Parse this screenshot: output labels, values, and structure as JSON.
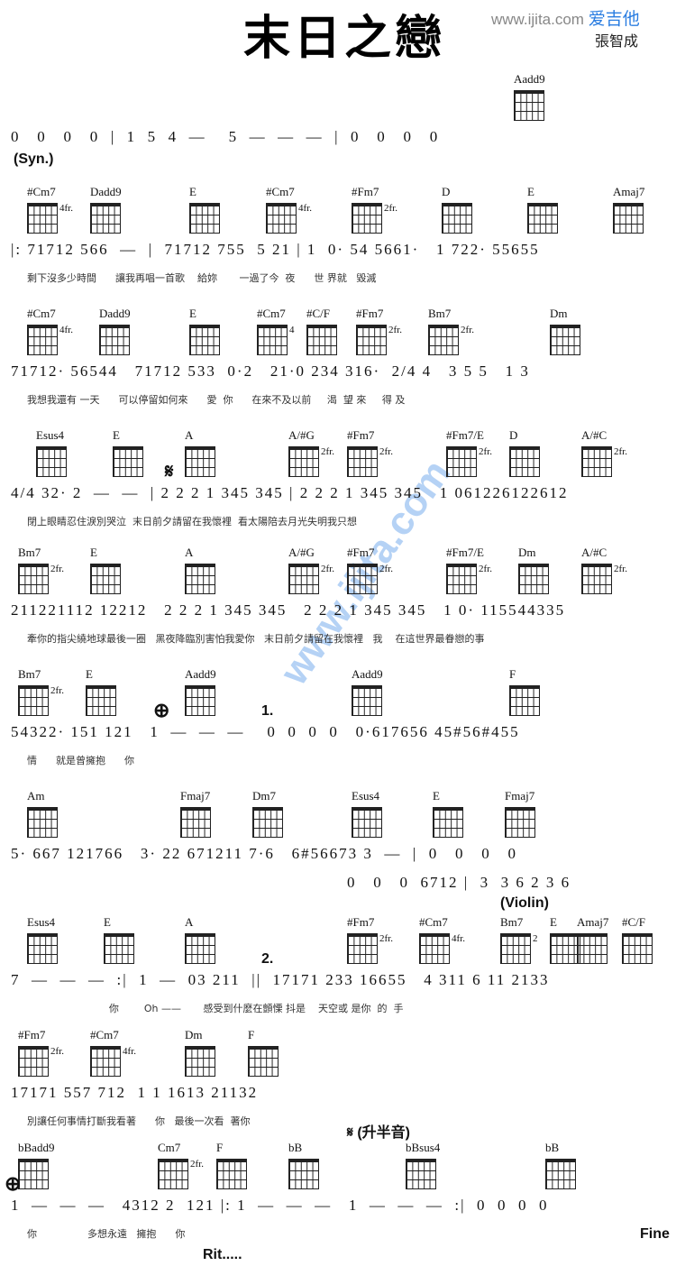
{
  "header": {
    "title": "末日之戀",
    "site": "www.ijita.com",
    "brand": "爱吉他",
    "artist": "張智成"
  },
  "watermark": "www.ijita.com",
  "lines": [
    {
      "chords": [
        {
          "name": "Aadd9"
        }
      ],
      "notes": "0   0   0   0  |  1  5  4  —    5  —  —  —  |  0   0   0   0",
      "lyrics": "",
      "label": "(Syn.)"
    },
    {
      "chords": [
        {
          "name": "#Cm7",
          "fr": "4fr."
        },
        {
          "name": "Dadd9"
        },
        {
          "name": "E"
        },
        {
          "name": "#Cm7",
          "fr": "4fr."
        },
        {
          "name": "#Fm7",
          "fr": "2fr."
        },
        {
          "name": "D"
        },
        {
          "name": "E"
        },
        {
          "name": "Amaj7"
        }
      ],
      "notes": "|: 71712 566  —  |  71712 755  5 21 | 1  0· 54 5661·   1 722· 55655",
      "lyrics": "剩下沒多少時間      讓我再唱一首歌    給妳       一過了今  夜      世 界就   毀滅"
    },
    {
      "chords": [
        {
          "name": "#Cm7",
          "fr": "4fr."
        },
        {
          "name": "Dadd9"
        },
        {
          "name": "E"
        },
        {
          "name": "#Cm7",
          "fr": "4"
        },
        {
          "name": "#C/F"
        },
        {
          "name": "#Fm7",
          "fr": "2fr."
        },
        {
          "name": "Bm7",
          "fr": "2fr."
        },
        {
          "name": "Dm"
        }
      ],
      "notes": "71712· 56544   71712 533  0·2   21·0 234 316·  2/4 4   3 5 5   1 3",
      "lyrics": "我想我還有 一天      可以停留如何來      愛  你      在來不及以前     渴  望 來     得 及"
    },
    {
      "chords": [
        {
          "name": "Esus4"
        },
        {
          "name": "E"
        },
        {
          "name": "A"
        },
        {
          "name": "A/#G",
          "fr": "2fr."
        },
        {
          "name": "#Fm7",
          "fr": "2fr."
        },
        {
          "name": "#Fm7/E",
          "fr": "2fr."
        },
        {
          "name": "D"
        },
        {
          "name": "A/#C",
          "fr": "2fr."
        }
      ],
      "notes": "4/4 32· 2  —  —  | 2 2 2 1 345 345 | 2 2 2 1 345 345   1 061226122612",
      "lyrics": "閉上眼睛忍住淚別哭泣  末日前夕請留在我懷裡  看太陽陪去月光失明我只想",
      "sign": "segno"
    },
    {
      "chords": [
        {
          "name": "Bm7",
          "fr": "2fr."
        },
        {
          "name": "E"
        },
        {
          "name": "A"
        },
        {
          "name": "A/#G",
          "fr": "2fr."
        },
        {
          "name": "#Fm7",
          "fr": "2fr."
        },
        {
          "name": "#Fm7/E",
          "fr": "2fr."
        },
        {
          "name": "Dm"
        },
        {
          "name": "A/#C",
          "fr": "2fr."
        }
      ],
      "notes": "211221112 12212   2 2 2 1 345 345   2 2 2 1 345 345   1 0· 115544335",
      "lyrics": "牽你的指尖繞地球最後一圈   黑夜降臨別害怕我愛你   末日前夕請留在我懷裡   我    在這世界最眷戀的事"
    },
    {
      "chords": [
        {
          "name": "Bm7",
          "fr": "2fr."
        },
        {
          "name": "E"
        },
        {
          "name": "Aadd9"
        },
        {
          "name": "Aadd9"
        },
        {
          "name": "F"
        }
      ],
      "notes": "54322· 151 121   1  —  —  —    0  0  0  0   0·617656 45#56#455",
      "lyrics": "情      就是曾擁抱      你",
      "ending": "1.",
      "sign": "coda"
    },
    {
      "chords": [
        {
          "name": "Am"
        },
        {
          "name": "Fmaj7"
        },
        {
          "name": "Dm7"
        },
        {
          "name": "Esus4"
        },
        {
          "name": "E"
        },
        {
          "name": "Fmaj7"
        }
      ],
      "notes": "5· 667 121766   3· 22 671211 7·6   6#56673 3  —  |  0   0   0   0",
      "notes2": "0   0   0  6712 |  3  3 6 2 3 6",
      "lyrics": "",
      "label": "(Violin)"
    },
    {
      "chords": [
        {
          "name": "Esus4"
        },
        {
          "name": "E"
        },
        {
          "name": "A"
        },
        {
          "name": "#Fm7",
          "fr": "2fr."
        },
        {
          "name": "#Cm7",
          "fr": "4fr."
        },
        {
          "name": "Bm7",
          "fr": "2"
        },
        {
          "name": "E"
        },
        {
          "name": "Amaj7"
        },
        {
          "name": "#C/F"
        }
      ],
      "notes": "7  —  —  —  :|  1  —  03 211  ||  17171 233 16655   4 311 6 11 2133",
      "lyrics": "                          你        Oh ——       感受到什麼在顫慄 抖是    天空或 是你  的  手",
      "ending": "2."
    },
    {
      "chords": [
        {
          "name": "#Fm7",
          "fr": "2fr."
        },
        {
          "name": "#Cm7",
          "fr": "4fr."
        },
        {
          "name": "Dm"
        },
        {
          "name": "F"
        }
      ],
      "notes": "17171 557 712  1 1 1613 21132",
      "lyrics": "別讓任何事情打斷我看著      你   最後一次看  著你",
      "label": "𝄋 (升半音)"
    },
    {
      "chords": [
        {
          "name": "bBadd9"
        },
        {
          "name": "Cm7",
          "fr": "2fr."
        },
        {
          "name": "F"
        },
        {
          "name": "bB"
        },
        {
          "name": "bBsus4"
        },
        {
          "name": "bB"
        }
      ],
      "notes": "1  —  —  —   4312 2  121 |: 1  —  —  —   1  —  —  —  :|  0  0  0  0",
      "lyrics": "你                多想永遠   擁抱      你",
      "label": "Rit.....",
      "end_label": "Fine",
      "sign": "coda"
    }
  ]
}
